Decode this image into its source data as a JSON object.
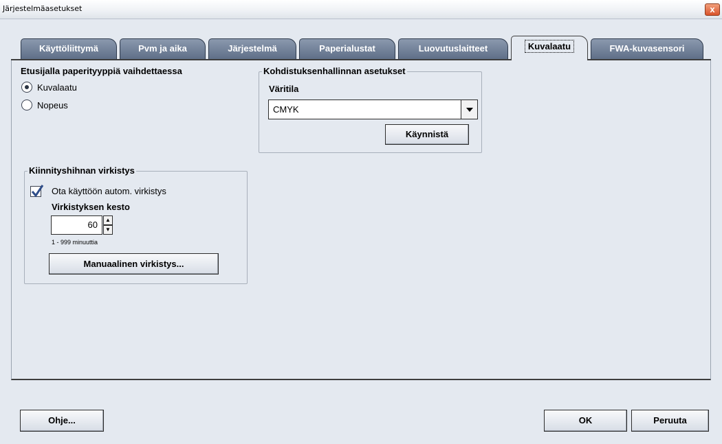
{
  "window": {
    "title": "Järjestelmäasetukset",
    "close_label": "x"
  },
  "tabs": [
    {
      "label": "Käyttöliittymä"
    },
    {
      "label": "Pvm ja aika"
    },
    {
      "label": "Järjestelmä"
    },
    {
      "label": "Paperialustat"
    },
    {
      "label": "Luovutuslaitteet"
    },
    {
      "label": "Kuvalaatu",
      "active": true
    },
    {
      "label": "FWA-kuvasensori"
    }
  ],
  "paper_switch": {
    "heading": "Etusijalla paperityyppiä vaihdettaessa",
    "options": [
      {
        "label": "Kuvalaatu",
        "selected": true
      },
      {
        "label": "Nopeus",
        "selected": false
      }
    ]
  },
  "color_management": {
    "legend": "Kohdistuksenhallinnan asetukset",
    "color_mode_label": "Väritila",
    "color_mode_value": "CMYK",
    "start_button": "Käynnistä"
  },
  "fuser_refresh": {
    "legend": "Kiinnityshihnan virkistys",
    "auto_checkbox_label": "Ota käyttöön autom. virkistys",
    "auto_checked": true,
    "duration_label": "Virkistyksen kesto",
    "duration_value": "60",
    "range_hint": "1 - 999 minuuttia",
    "manual_button": "Manuaalinen virkistys..."
  },
  "footer": {
    "help_button": "Ohje...",
    "ok_button": "OK",
    "cancel_button": "Peruuta"
  },
  "icons": {
    "close": "close-icon",
    "dropdown": "chevron-down-icon",
    "spin_up": "arrow-up-icon",
    "spin_down": "arrow-down-icon",
    "check": "checkmark-icon"
  }
}
